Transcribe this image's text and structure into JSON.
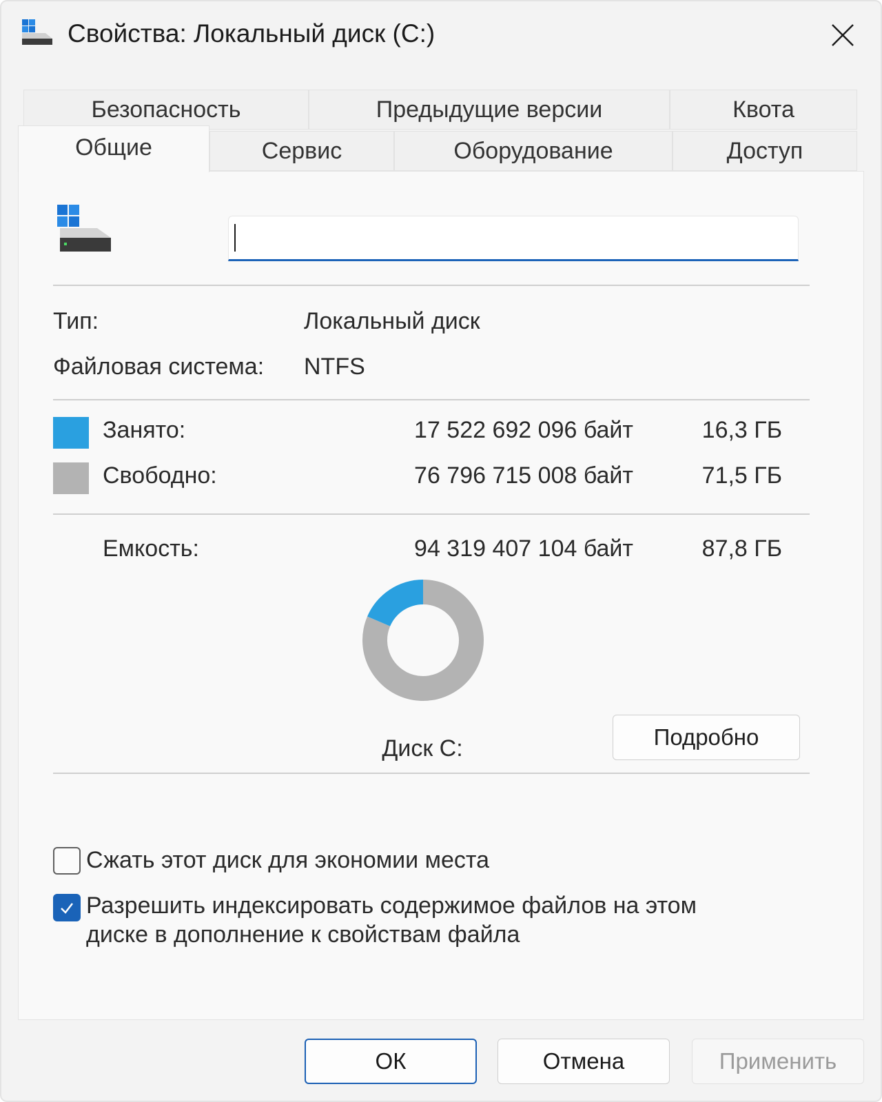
{
  "window": {
    "title": "Свойства: Локальный диск (C:)"
  },
  "tabs": {
    "row1": [
      {
        "label": "Безопасность"
      },
      {
        "label": "Предыдущие версии"
      },
      {
        "label": "Квота"
      }
    ],
    "row2": [
      {
        "label": "Общие",
        "active": true
      },
      {
        "label": "Сервис"
      },
      {
        "label": "Оборудование"
      },
      {
        "label": "Доступ"
      }
    ]
  },
  "general": {
    "name_value": "",
    "type_label": "Тип:",
    "type_value": "Локальный диск",
    "fs_label": "Файловая система:",
    "fs_value": "NTFS",
    "used": {
      "label": "Занято:",
      "bytes": "17 522 692 096 байт",
      "size": "16,3 ГБ",
      "color": "#2aa0e0"
    },
    "free": {
      "label": "Свободно:",
      "bytes": "76 796 715 008 байт",
      "size": "71,5 ГБ",
      "color": "#b3b3b3"
    },
    "capacity": {
      "label": "Емкость:",
      "bytes": "94 319 407 104 байт",
      "size": "87,8 ГБ"
    },
    "used_fraction": 0.1858,
    "disk_label": "Диск C:",
    "details_button": "Подробно",
    "compress": {
      "label": "Сжать этот диск для экономии места",
      "checked": false
    },
    "index": {
      "label": "Разрешить индексировать содержимое файлов на этом диске в дополнение к свойствам файла",
      "checked": true
    }
  },
  "footer": {
    "ok": "ОК",
    "cancel": "Отмена",
    "apply": "Применить"
  },
  "colors": {
    "accent": "#1a63b8"
  }
}
